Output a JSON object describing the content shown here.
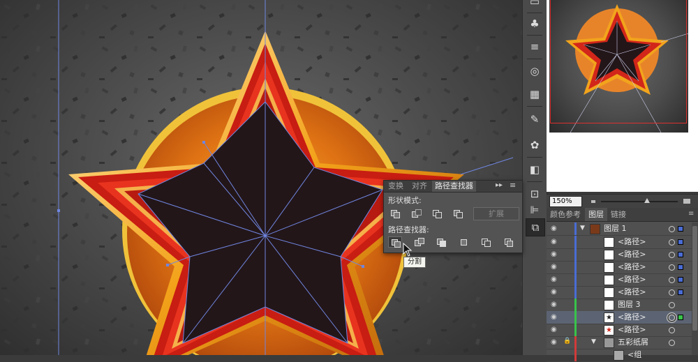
{
  "navigator": {
    "zoom_value": "150%"
  },
  "pathfinder_panel": {
    "tabs": [
      {
        "label": "变换",
        "active": false
      },
      {
        "label": "对齐",
        "active": false
      },
      {
        "label": "路径查找器",
        "active": true
      }
    ],
    "shape_modes_label": "形状模式:",
    "pathfinders_label": "路径查找器:",
    "expand_label": "扩展",
    "tooltip": "分割",
    "shape_mode_buttons": [
      "unite-icon",
      "minus-front-icon",
      "intersect-icon",
      "exclude-icon"
    ],
    "pathfinder_buttons": [
      "divide-icon",
      "trim-icon",
      "merge-icon",
      "crop-icon",
      "outline-icon",
      "minus-back-icon"
    ]
  },
  "layers_panel": {
    "tabs": [
      {
        "label": "颜色参考",
        "active": false
      },
      {
        "label": "图层",
        "active": true
      },
      {
        "label": "链接",
        "active": false
      }
    ],
    "rows": [
      {
        "name": "图层 1",
        "type": "layer",
        "expanded": true
      },
      {
        "name": "<路径>",
        "type": "path"
      },
      {
        "name": "<路径>",
        "type": "path"
      },
      {
        "name": "<路径>",
        "type": "path"
      },
      {
        "name": "<路径>",
        "type": "path"
      },
      {
        "name": "<路径>",
        "type": "path"
      },
      {
        "name": "图层 3",
        "type": "sublayer"
      },
      {
        "name": "<路径>",
        "type": "path",
        "selected": true
      },
      {
        "name": "<路径>",
        "type": "path"
      },
      {
        "name": "五彩纸屑",
        "type": "group",
        "locked": true
      },
      {
        "name": "<组",
        "type": "group"
      }
    ]
  },
  "colors": {
    "accent_blue": "#4a6cd4",
    "layer_green": "#39c34a",
    "layer_red": "#d23a3a",
    "star_red": "#e0261a",
    "star_gold": "#f2a41c",
    "star_dark": "#2a1a1c"
  },
  "toolstrip": [
    "doc-icon",
    "club-icon",
    "lines-icon",
    "appearance-icon",
    "swatch-grid-icon",
    "brush-icon",
    "palette-icon",
    "gradient-icon",
    "transform-icon",
    "align-icon",
    "pathfinder-icon"
  ]
}
